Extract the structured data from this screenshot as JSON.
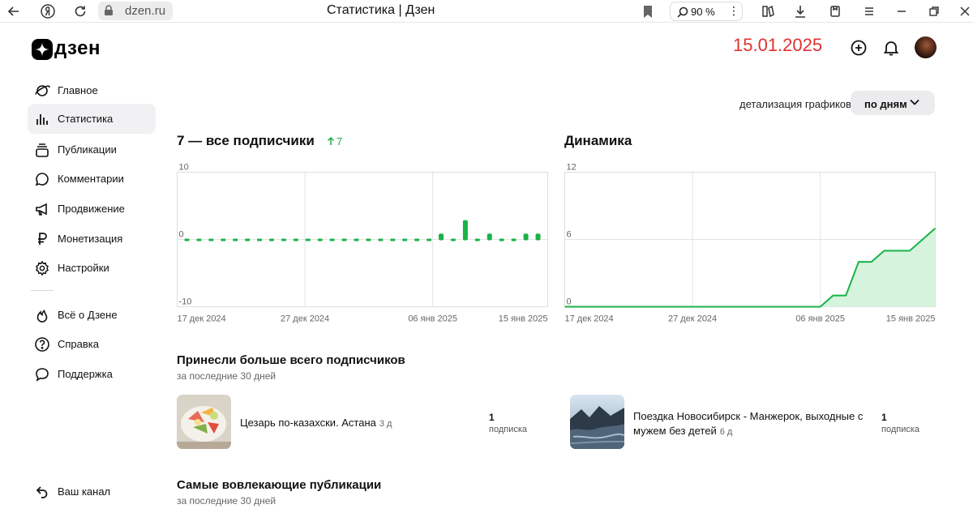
{
  "browser": {
    "url": "dzen.ru",
    "tab_title": "Статистика | Дзен",
    "zoom": "90 %"
  },
  "header": {
    "logo_text": "дзен",
    "date_stamp": "15.01.2025"
  },
  "sidebar": {
    "items": [
      {
        "label": "Главное",
        "icon": "planet-icon"
      },
      {
        "label": "Статистика",
        "icon": "bar-chart-icon",
        "active": true
      },
      {
        "label": "Публикации",
        "icon": "publications-icon"
      },
      {
        "label": "Комментарии",
        "icon": "comment-icon"
      },
      {
        "label": "Продвижение",
        "icon": "megaphone-icon"
      },
      {
        "label": "Монетизация",
        "icon": "ruble-icon"
      },
      {
        "label": "Настройки",
        "icon": "gear-icon"
      }
    ],
    "secondary": [
      {
        "label": "Всё о Дзене",
        "icon": "flame-icon"
      },
      {
        "label": "Справка",
        "icon": "help-icon"
      },
      {
        "label": "Поддержка",
        "icon": "support-chat-icon"
      }
    ],
    "footer": {
      "label": "Ваш канал",
      "icon": "back-arrow-icon"
    }
  },
  "detail": {
    "label": "детализация графиков",
    "value": "по дням"
  },
  "subscribers": {
    "title": "7 — все подписчики",
    "delta": "7"
  },
  "dynamics": {
    "title": "Динамика"
  },
  "chart_data": [
    {
      "type": "bar",
      "title": "7 — все подписчики",
      "y_ticks": [
        "10",
        "0",
        "-10"
      ],
      "ylim": [
        -10,
        10
      ],
      "x_ticks": [
        "17 дек 2024",
        "27 дек 2024",
        "06 янв 2025",
        "15 янв 2025"
      ],
      "categories": [
        "17.12",
        "18.12",
        "19.12",
        "20.12",
        "21.12",
        "22.12",
        "23.12",
        "24.12",
        "25.12",
        "26.12",
        "27.12",
        "28.12",
        "29.12",
        "30.12",
        "31.12",
        "01.01",
        "02.01",
        "03.01",
        "04.01",
        "05.01",
        "06.01",
        "07.01",
        "08.01",
        "09.01",
        "10.01",
        "11.01",
        "12.01",
        "13.01",
        "14.01",
        "15.01"
      ],
      "values": [
        0,
        0,
        0,
        0,
        0,
        0,
        0,
        0,
        0,
        0,
        0,
        0,
        0,
        0,
        0,
        0,
        0,
        0,
        0,
        0,
        0,
        1,
        0,
        3,
        0,
        1,
        0,
        0,
        1,
        1
      ],
      "color": "#19b347"
    },
    {
      "type": "area",
      "title": "Динамика",
      "y_ticks": [
        "12",
        "6",
        "0"
      ],
      "ylim": [
        0,
        12
      ],
      "x_ticks": [
        "17 дек 2024",
        "27 дек 2024",
        "06 янв 2025",
        "15 янв 2025"
      ],
      "categories": [
        "17.12",
        "18.12",
        "19.12",
        "20.12",
        "21.12",
        "22.12",
        "23.12",
        "24.12",
        "25.12",
        "26.12",
        "27.12",
        "28.12",
        "29.12",
        "30.12",
        "31.12",
        "01.01",
        "02.01",
        "03.01",
        "04.01",
        "05.01",
        "06.01",
        "07.01",
        "08.01",
        "09.01",
        "10.01",
        "11.01",
        "12.01",
        "13.01",
        "14.01",
        "15.01"
      ],
      "values": [
        0,
        0,
        0,
        0,
        0,
        0,
        0,
        0,
        0,
        0,
        0,
        0,
        0,
        0,
        0,
        0,
        0,
        0,
        0,
        0,
        0,
        1,
        1,
        4,
        4,
        5,
        5,
        5,
        6,
        7
      ],
      "color": "#19b347"
    }
  ],
  "top_subscribers": {
    "title": "Принесли больше всего подписчиков",
    "subtitle": "за последние 30 дней",
    "items": [
      {
        "title": "Цезарь по-казахски. Астана",
        "age": "3 д",
        "count": "1",
        "unit": "подписка"
      },
      {
        "title_line1": "Поездка Новосибирск - Манжерок, выходные с",
        "title_line2": "мужем без детей",
        "age": "6 д",
        "count": "1",
        "unit": "подписка"
      }
    ]
  },
  "engaging": {
    "title": "Самые вовлекающие публикации",
    "subtitle": "за последние 30 дней"
  }
}
